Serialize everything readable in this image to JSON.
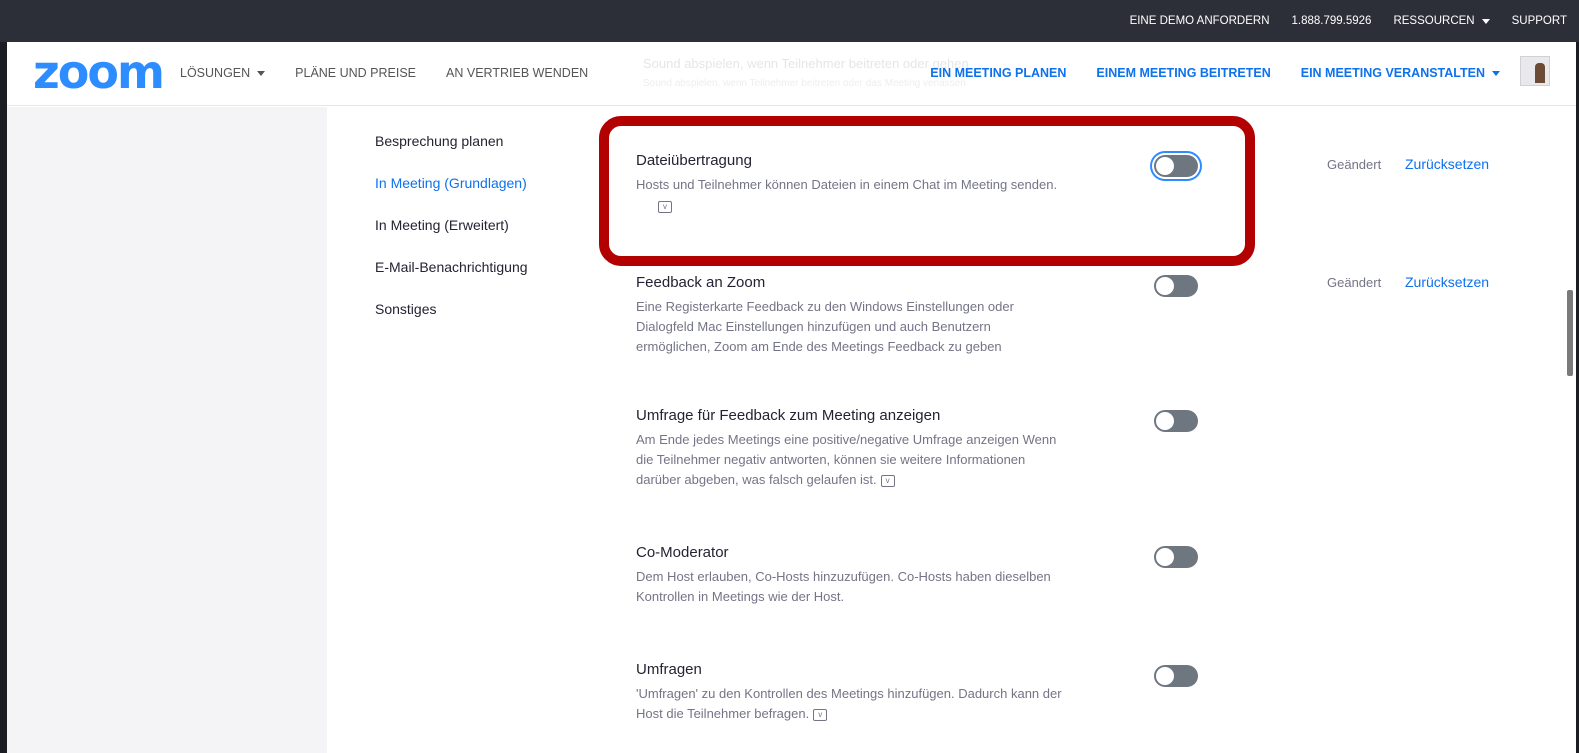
{
  "topbar": {
    "demo": "EINE DEMO ANFORDERN",
    "phone": "1.888.799.5926",
    "resources": "RESSOURCEN",
    "support": "SUPPORT"
  },
  "navbar": {
    "logo": "zoom",
    "solutions": "LÖSUNGEN",
    "plans": "PLÄNE UND PREISE",
    "sales": "AN VERTRIEB WENDEN",
    "schedule": "EIN MEETING PLANEN",
    "join": "EINEM MEETING BEITRETEN",
    "host": "EIN MEETING VERANSTALTEN",
    "ghost_title": "Sound abspielen, wenn Teilnehmer beitreten oder gehen",
    "ghost_desc": "Sound abspielen, wenn Teilnehmer beitreten oder das Meeting verlassen"
  },
  "subnav": {
    "items": [
      {
        "label": "Besprechung planen"
      },
      {
        "label": "In Meeting (Grundlagen)"
      },
      {
        "label": "In Meeting (Erweitert)"
      },
      {
        "label": "E-Mail-Benachrichtigung"
      },
      {
        "label": "Sonstiges"
      }
    ]
  },
  "settings": [
    {
      "title": "Dateiübertragung",
      "desc": "Hosts und Teilnehmer können Dateien in einem Chat im Meeting senden.",
      "status": "Geändert",
      "reset": "Zurücksetzen",
      "enabled": false
    },
    {
      "title": "Feedback an Zoom",
      "desc_lines": [
        "Eine Registerkarte Feedback zu den Windows Einstellungen oder",
        "Dialogfeld Mac Einstellungen hinzufügen und auch Benutzern",
        "ermöglichen, Zoom am Ende des Meetings Feedback zu geben"
      ],
      "status": "Geändert",
      "reset": "Zurücksetzen",
      "enabled": false
    },
    {
      "title": "Umfrage für Feedback zum Meeting anzeigen",
      "desc_lines": [
        "Am Ende jedes Meetings eine positive/negative Umfrage anzeigen Wenn",
        "die Teilnehmer negativ antworten, können sie weitere Informationen",
        "darüber abgeben, was falsch gelaufen ist."
      ],
      "enabled": false
    },
    {
      "title": "Co-Moderator",
      "desc_lines": [
        "Dem Host erlauben, Co-Hosts hinzuzufügen. Co-Hosts haben dieselben",
        "Kontrollen in Meetings wie der Host."
      ],
      "enabled": false
    },
    {
      "title": "Umfragen",
      "desc_lines": [
        "'Umfragen' zu den Kontrollen des Meetings hinzufügen. Dadurch kann der",
        "Host die Teilnehmer befragen."
      ],
      "enabled": false
    }
  ],
  "colors": {
    "accent": "#0e72ed",
    "logo": "#2d8cff",
    "highlight": "#b30000",
    "toggle_off": "#6e7680"
  }
}
